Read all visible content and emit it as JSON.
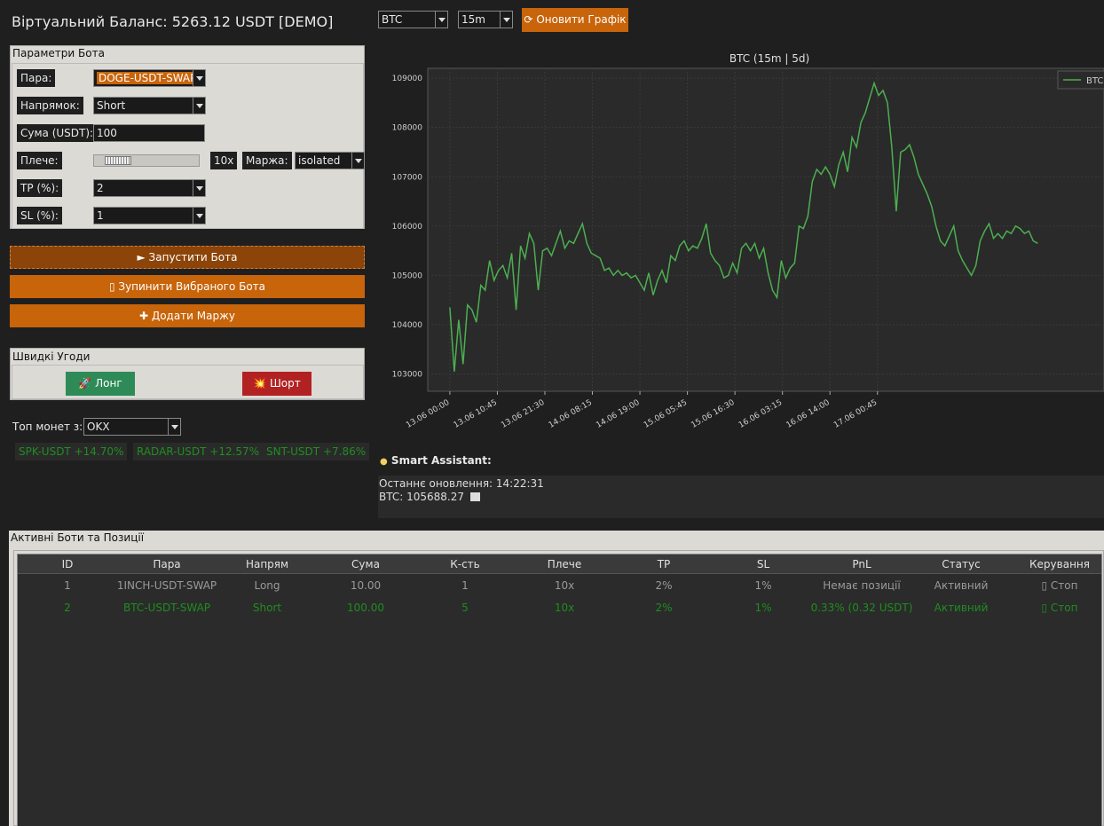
{
  "balance_text": "Віртуальний Баланс: 5263.12 USDT  [DEMO]",
  "toolbar": {
    "symbol": "BTC",
    "interval": "15m",
    "refresh_label": "Оновити Графік",
    "refresh_icon": "refresh-icon"
  },
  "params": {
    "title": "Параметри Бота",
    "pair_label": "Пара:",
    "pair_value": "DOGE-USDT-SWAP",
    "direction_label": "Напрямок:",
    "direction_value": "Short",
    "amount_label": "Сума (USDT):",
    "amount_value": "100",
    "leverage_label": "Плече:",
    "leverage_value": "10x",
    "leverage_fraction": 0.1,
    "margin_label": "Маржа:",
    "margin_value": "isolated",
    "tp_label": "TP (%):",
    "tp_value": "2",
    "sl_label": "SL (%):",
    "sl_value": "1"
  },
  "actions": {
    "start_label": "► Запустити Бота",
    "stop_label": "▯ Зупинити Вибраного Бота",
    "add_margin_label": "✚ Додати Маржу"
  },
  "quick": {
    "title": "Швидкі Угоди",
    "long_label": "🚀 Лонг",
    "short_label": "💥 Шорт",
    "long_color": "#2e8b57",
    "short_color": "#b22222"
  },
  "top_coins": {
    "label": "Топ монет з:",
    "exchange": "OKX",
    "items": [
      "SPK-USDT +14.70%",
      "RADAR-USDT +12.57%",
      "SNT-USDT +7.86%"
    ]
  },
  "chart_data": {
    "type": "line",
    "title": "BTC (15m | 5d)",
    "legend": "BTC",
    "legend_position": "top-right",
    "line_color": "#4caf50",
    "grid": true,
    "ylim": [
      102650,
      109200
    ],
    "yticks": [
      103000,
      104000,
      105000,
      106000,
      107000,
      108000,
      109000
    ],
    "xtick_labels": [
      "13.06 00:00",
      "13.06 10:45",
      "13.06 21:30",
      "14.06 08:15",
      "14.06 19:00",
      "15.06 05:45",
      "15.06 16:30",
      "16.06 03:15",
      "16.06 14:00",
      "17.06 00:45"
    ],
    "series": [
      {
        "name": "BTC",
        "x_hours": [
          0,
          1,
          2,
          3,
          4,
          5,
          6,
          7,
          8,
          9,
          10,
          11,
          12,
          13,
          14,
          15,
          16,
          17,
          18,
          19,
          20,
          21,
          22,
          23,
          24,
          25,
          26,
          27,
          28,
          29,
          30,
          31,
          32,
          33,
          34,
          35,
          36,
          37,
          38,
          39,
          40,
          41,
          42,
          43,
          44,
          45,
          46,
          47,
          48,
          49,
          50,
          51,
          52,
          53,
          54,
          55,
          56,
          57,
          58,
          59,
          60,
          61,
          62,
          63,
          64,
          65,
          66,
          67,
          68,
          69,
          70,
          71,
          72,
          73,
          74,
          75,
          76,
          77,
          78,
          79,
          80,
          81,
          82,
          83,
          84,
          85,
          86,
          87,
          88,
          89,
          90,
          91,
          92,
          93,
          94,
          95,
          96,
          97,
          98,
          99,
          100,
          101,
          102,
          103,
          104,
          105,
          106,
          107,
          108,
          109,
          110,
          111,
          112,
          113,
          114,
          115,
          116,
          117,
          118,
          119,
          120,
          121,
          122,
          123,
          124,
          125,
          126,
          127,
          128,
          129,
          130,
          131,
          132,
          133
        ],
        "values": [
          104350,
          103050,
          104100,
          103200,
          104400,
          104300,
          104050,
          104800,
          104700,
          105300,
          104900,
          105100,
          105200,
          104950,
          105450,
          104300,
          105600,
          105350,
          105850,
          105650,
          104700,
          105500,
          105550,
          105400,
          105650,
          105900,
          105550,
          105700,
          105650,
          105850,
          106050,
          105650,
          105450,
          105400,
          105350,
          105100,
          105150,
          105000,
          105100,
          105000,
          105050,
          104950,
          105000,
          104850,
          104700,
          105050,
          104600,
          104900,
          105100,
          104850,
          105400,
          105300,
          105600,
          105700,
          105500,
          105600,
          105550,
          105750,
          106050,
          105450,
          105300,
          105200,
          104950,
          105000,
          105250,
          105050,
          105550,
          105650,
          105500,
          105650,
          105350,
          105550,
          105050,
          104700,
          104550,
          105300,
          104950,
          105150,
          105250,
          106000,
          105950,
          106200,
          106900,
          107150,
          107050,
          107200,
          107050,
          106800,
          107250,
          107500,
          107100,
          107800,
          107600,
          108100,
          108300,
          108600,
          108900,
          108650,
          108750,
          108500,
          107600,
          106300,
          107500,
          107550,
          107650,
          107400,
          107050,
          106850,
          106650,
          106400,
          106000,
          105700,
          105600,
          105800,
          106000,
          105500,
          105300,
          105150,
          105000,
          105200,
          105700,
          105900,
          106050,
          105750,
          105850,
          105750,
          105900,
          105850,
          106000,
          105950,
          105850,
          105900,
          105700,
          105650
        ]
      }
    ]
  },
  "assistant": {
    "title": "Smart Assistant:",
    "title_icon": "lightbulb-icon",
    "updated_line": "Останнє оновлення: 14:22:31",
    "price_line": "BTC: 105688.27",
    "trend_icon": "chart-down-icon"
  },
  "bots": {
    "title": "Активні Боти та Позиції",
    "columns": [
      "ID",
      "Пара",
      "Напрям",
      "Сума",
      "К-сть",
      "Плече",
      "TP",
      "SL",
      "PnL",
      "Статус",
      "Керування"
    ],
    "rows": [
      {
        "id": "1",
        "pair": "1INCH-USDT-SWAP",
        "direction": "Long",
        "amount": "10.00",
        "qty": "1",
        "leverage": "10x",
        "tp": "2%",
        "sl": "1%",
        "pnl": "Немає позиції",
        "status": "Активний",
        "control": "▯ Стоп"
      },
      {
        "id": "2",
        "pair": "BTC-USDT-SWAP",
        "direction": "Short",
        "amount": "100.00",
        "qty": "5",
        "leverage": "10x",
        "tp": "2%",
        "sl": "1%",
        "pnl": "0.33% (0.32 USDT)",
        "status": "Активний",
        "control": "▯ Стоп"
      }
    ]
  }
}
